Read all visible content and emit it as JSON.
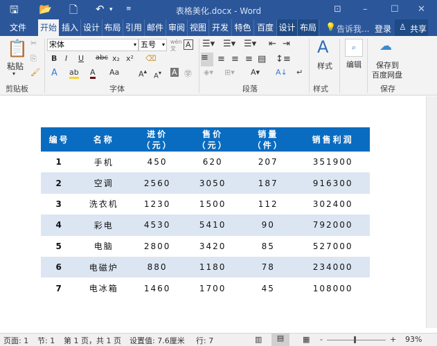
{
  "title": "表格美化.docx - Word",
  "tabs": [
    "文件",
    "开始",
    "插入",
    "设计",
    "布局",
    "引用",
    "邮件",
    "审阅",
    "视图",
    "开发",
    "特色",
    "百度",
    "设计",
    "布局"
  ],
  "tell_me": "告诉我...",
  "login": "登录",
  "share": "共享",
  "ribbon": {
    "paste": "粘贴",
    "clipboard": "剪贴板",
    "font_name": "宋体",
    "font_size": "五号",
    "font_group": "字体",
    "paragraph_group": "段落",
    "styles": "样式",
    "styles_group": "样式",
    "edit": "编辑",
    "save_baidu": "保存到",
    "save_baidu2": "百度网盘",
    "save_group": "保存",
    "bold": "B",
    "italic": "I",
    "underline": "U",
    "strike": "abc",
    "sub": "x₂",
    "sup": "x²",
    "aa": "Aa"
  },
  "table": {
    "headers": [
      [
        "编号"
      ],
      [
        "名称"
      ],
      [
        "进价",
        "（元）"
      ],
      [
        "售价",
        "（元）"
      ],
      [
        "销量",
        "（件）"
      ],
      [
        "销售利润"
      ]
    ],
    "rows": [
      [
        "1",
        "手机",
        "450",
        "620",
        "207",
        "351900"
      ],
      [
        "2",
        "空调",
        "2560",
        "3050",
        "187",
        "916300"
      ],
      [
        "3",
        "洗衣机",
        "1230",
        "1500",
        "112",
        "302400"
      ],
      [
        "4",
        "彩电",
        "4530",
        "5410",
        "90",
        "792000"
      ],
      [
        "5",
        "电脑",
        "2800",
        "3420",
        "85",
        "527000"
      ],
      [
        "6",
        "电磁炉",
        "880",
        "1180",
        "78",
        "234000"
      ],
      [
        "7",
        "电冰箱",
        "1460",
        "1700",
        "45",
        "108000"
      ]
    ]
  },
  "status": {
    "page": "页面: 1",
    "section": "节: 1",
    "pages": "第 1 页，共 1 页",
    "setting": "设置值: 7.6厘米",
    "line": "行: 7",
    "zoom": "93%"
  }
}
